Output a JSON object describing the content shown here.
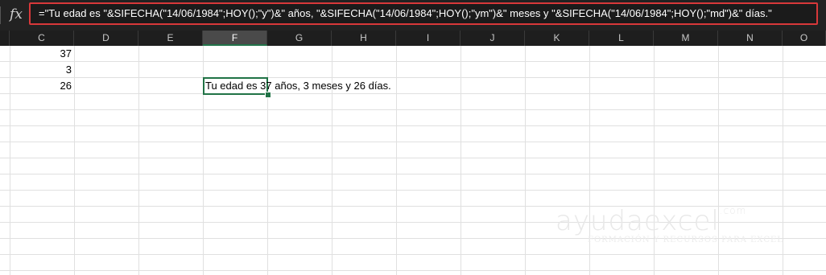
{
  "formula_bar": {
    "fx_label": "fx",
    "formula": "=\"Tu edad es \"&SIFECHA(\"14/06/1984\";HOY();\"y\")&\" años, \"&SIFECHA(\"14/06/1984\";HOY();\"ym\")&\" meses y \"&SIFECHA(\"14/06/1984\";HOY();\"md\")&\" días.\""
  },
  "columns": [
    "C",
    "D",
    "E",
    "F",
    "G",
    "H",
    "I",
    "J",
    "K",
    "L",
    "M",
    "N",
    "O"
  ],
  "active_column": "F",
  "cells": {
    "c1": "37",
    "c2": "3",
    "c3": "26",
    "f3": "Tu edad es 37 años, 3 meses y 26 días."
  },
  "watermark": {
    "main": "ayudaexcel",
    "domain": ".com",
    "tagline": "FORMACIÓN Y RECURSOS PARA EXCEL"
  },
  "colors": {
    "highlight_border": "#d8383a",
    "selection": "#217346"
  }
}
